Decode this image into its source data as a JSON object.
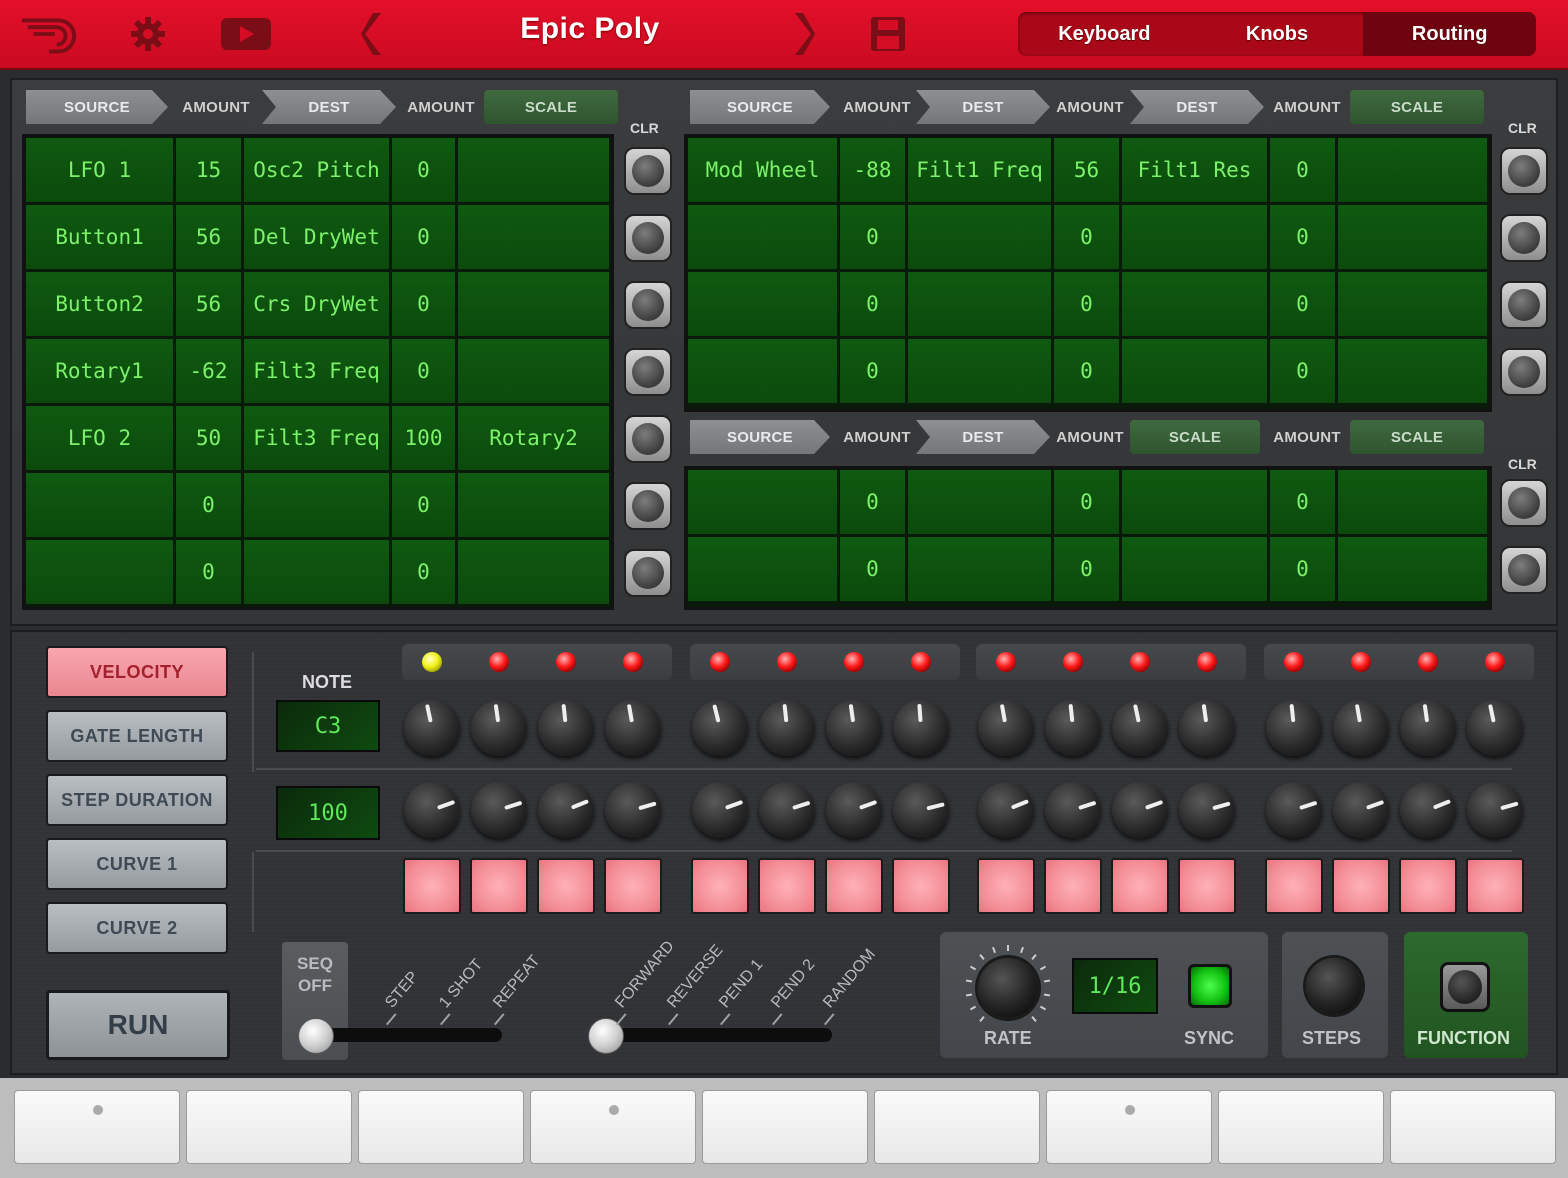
{
  "header": {
    "title": "Epic Poly",
    "tabs": [
      {
        "label": "Keyboard",
        "active": false
      },
      {
        "label": "Knobs",
        "active": false
      },
      {
        "label": "Routing",
        "active": true
      }
    ],
    "icons": [
      "logo-icon",
      "gear-icon",
      "video-icon",
      "prev-preset-icon",
      "next-preset-icon",
      "save-icon"
    ]
  },
  "routing": {
    "left": {
      "headers": [
        "SOURCE",
        "AMOUNT",
        "DEST",
        "AMOUNT",
        "SCALE"
      ],
      "clr_label": "CLR",
      "rows": [
        [
          "LFO 1",
          "15",
          "Osc2 Pitch",
          "0",
          ""
        ],
        [
          "Button1",
          "56",
          "Del DryWet",
          "0",
          ""
        ],
        [
          "Button2",
          "56",
          "Crs DryWet",
          "0",
          ""
        ],
        [
          "Rotary1",
          "-62",
          "Filt3 Freq",
          "0",
          ""
        ],
        [
          "LFO 2",
          "50",
          "Filt3 Freq",
          "100",
          "Rotary2"
        ],
        [
          "",
          "0",
          "",
          "0",
          ""
        ],
        [
          "",
          "0",
          "",
          "0",
          ""
        ]
      ]
    },
    "right_top": {
      "headers": [
        "SOURCE",
        "AMOUNT",
        "DEST",
        "AMOUNT",
        "DEST",
        "AMOUNT",
        "SCALE"
      ],
      "clr_label": "CLR",
      "rows": [
        [
          "Mod Wheel",
          "-88",
          "Filt1 Freq",
          "56",
          "Filt1 Res",
          "0",
          ""
        ],
        [
          "",
          "0",
          "",
          "0",
          "",
          "0",
          ""
        ],
        [
          "",
          "0",
          "",
          "0",
          "",
          "0",
          ""
        ],
        [
          "",
          "0",
          "",
          "0",
          "",
          "0",
          ""
        ]
      ]
    },
    "right_bottom": {
      "headers": [
        "SOURCE",
        "AMOUNT",
        "DEST",
        "AMOUNT",
        "SCALE",
        "AMOUNT",
        "SCALE"
      ],
      "clr_label": "CLR",
      "rows": [
        [
          "",
          "0",
          "",
          "0",
          "",
          "0",
          ""
        ],
        [
          "",
          "0",
          "",
          "0",
          "",
          "0",
          ""
        ]
      ]
    }
  },
  "sequencer": {
    "modes": [
      {
        "label": "VELOCITY",
        "active": true
      },
      {
        "label": "GATE LENGTH",
        "active": false
      },
      {
        "label": "STEP DURATION",
        "active": false
      },
      {
        "label": "CURVE 1",
        "active": false
      },
      {
        "label": "CURVE 2",
        "active": false
      }
    ],
    "run_label": "RUN",
    "note_label": "NOTE",
    "note_value": "C3",
    "velocity_value": "100",
    "active_step": 1,
    "steps": 16,
    "seq_off_line1": "SEQ",
    "seq_off_line2": "OFF",
    "play_modes": [
      "STEP",
      "1 SHOT",
      "REPEAT"
    ],
    "directions": [
      "FORWARD",
      "REVERSE",
      "PEND 1",
      "PEND 2",
      "RANDOM"
    ],
    "rate_label": "RATE",
    "rate_value": "1/16",
    "sync_label": "SYNC",
    "steps_label": "STEPS",
    "function_label": "FUNCTION",
    "colors": {
      "led_active": "#f1f118",
      "led": "#ff1a1a",
      "pad": "#f28a93",
      "sync": "#12c012"
    }
  },
  "keyboard": {
    "white_keys": 9,
    "marked_keys": [
      0,
      3,
      6
    ]
  }
}
